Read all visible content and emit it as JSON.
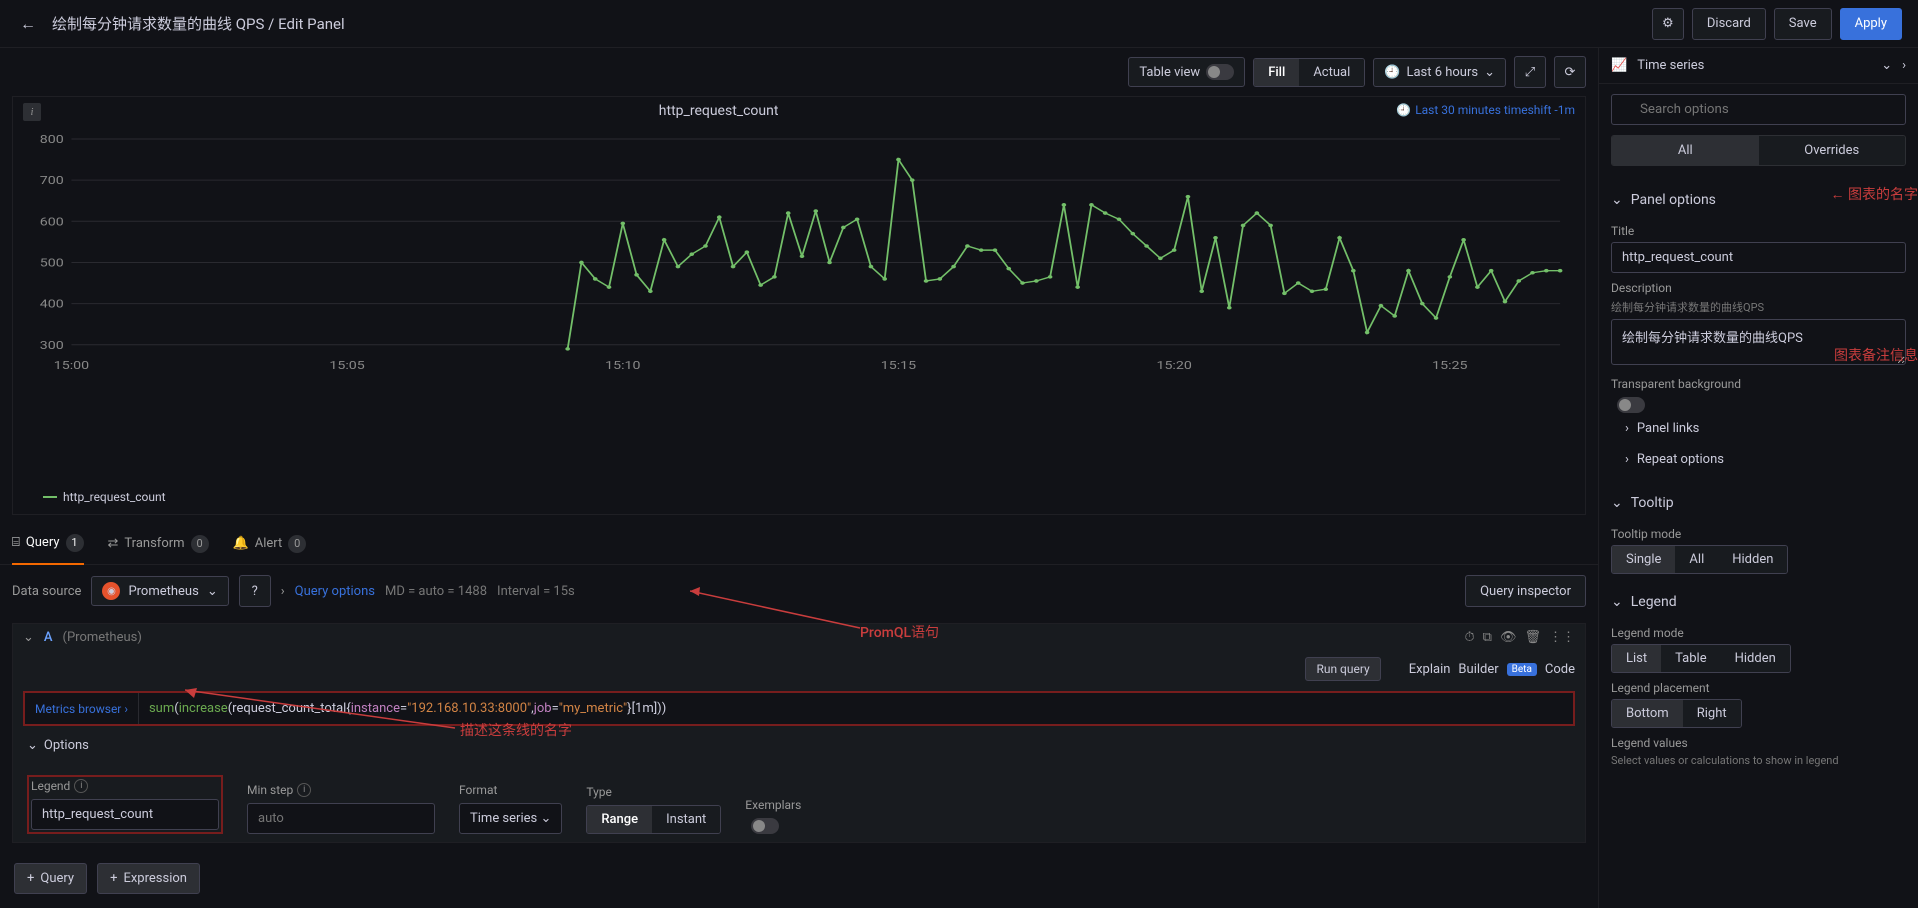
{
  "header": {
    "breadcrumb_dashboard": "绘制每分钟请求数量的曲线 QPS",
    "breadcrumb_sep": " / ",
    "breadcrumb_page": "Edit Panel",
    "discard": "Discard",
    "save": "Save",
    "apply": "Apply"
  },
  "toolbar": {
    "table_view": "Table view",
    "fill": "Fill",
    "actual": "Actual",
    "time_range": "Last 6 hours"
  },
  "panel": {
    "title": "http_request_count",
    "timeshift_label": "Last 30 minutes timeshift -1m",
    "legend_series": "http_request_count",
    "y_ticks": [
      "800",
      "700",
      "600",
      "500",
      "400",
      "300"
    ],
    "x_ticks": [
      "15:00",
      "15:05",
      "15:10",
      "15:15",
      "15:20",
      "15:25"
    ]
  },
  "tabs": {
    "query": "Query",
    "query_n": "1",
    "transform": "Transform",
    "transform_n": "0",
    "alert": "Alert",
    "alert_n": "0"
  },
  "datasource": {
    "label": "Data source",
    "name": "Prometheus",
    "query_options": "Query options",
    "md_info": "MD = auto = 1488",
    "interval_info": "Interval = 15s",
    "inspector": "Query inspector"
  },
  "query": {
    "letter": "A",
    "ds_hint": "(Prometheus)",
    "run": "Run query",
    "explain": "Explain",
    "builder": "Builder",
    "beta": "Beta",
    "code": "Code",
    "metrics_browser": "Metrics browser",
    "promql": {
      "fn1": "sum",
      "p1": "(",
      "fn2": "increase",
      "p2": "(request_count_total{",
      "k1": "instance",
      "eq1": "=",
      "v1": "\"192.168.10.33:8000\"",
      "c1": ",",
      "k2": "job",
      "eq2": "=",
      "v2": "\"my_metric\"",
      "p3": "}[1m]))"
    },
    "options_label": "Options",
    "legend_label": "Legend",
    "legend_value": "http_request_count",
    "minstep_label": "Min step",
    "minstep_placeholder": "auto",
    "format_label": "Format",
    "format_value": "Time series",
    "type_label": "Type",
    "type_range": "Range",
    "type_instant": "Instant",
    "exemplars_label": "Exemplars",
    "add_query": "Query",
    "add_expr": "Expression"
  },
  "sidebar": {
    "vis_name": "Time series",
    "search_placeholder": "Search options",
    "tab_all": "All",
    "tab_over": "Overrides",
    "panel_options": "Panel options",
    "title_label": "Title",
    "title_value": "http_request_count",
    "desc_label": "Description",
    "desc_hint": "绘制每分钟请求数量的曲线QPS",
    "desc_value": "绘制每分钟请求数量的曲线QPS",
    "transparent_label": "Transparent background",
    "panel_links": "Panel links",
    "repeat": "Repeat options",
    "tooltip": "Tooltip",
    "tooltip_mode": "Tooltip mode",
    "tm_single": "Single",
    "tm_all": "All",
    "tm_hidden": "Hidden",
    "legend": "Legend",
    "legend_mode": "Legend mode",
    "lm_list": "List",
    "lm_table": "Table",
    "lm_hidden": "Hidden",
    "legend_place": "Legend placement",
    "lp_bottom": "Bottom",
    "lp_right": "Right",
    "legend_values": "Legend values",
    "legend_values_hint": "Select values or calculations to show in legend"
  },
  "annotations": {
    "a1": "图表的名字",
    "a2": "图表备注信息",
    "a3": "PromQL语句",
    "a4": "描述这条线的名字"
  },
  "chart_data": {
    "type": "line",
    "title": "http_request_count",
    "ylabel": "",
    "xlabel": "",
    "ylim": [
      280,
      800
    ],
    "x": [
      "15:09:00",
      "15:09:15",
      "15:09:30",
      "15:09:45",
      "15:10:00",
      "15:10:15",
      "15:10:30",
      "15:10:45",
      "15:11:00",
      "15:11:15",
      "15:11:30",
      "15:11:45",
      "15:12:00",
      "15:12:15",
      "15:12:30",
      "15:12:45",
      "15:13:00",
      "15:13:15",
      "15:13:30",
      "15:13:45",
      "15:14:00",
      "15:14:15",
      "15:14:30",
      "15:14:45",
      "15:15:00",
      "15:15:15",
      "15:15:30",
      "15:15:45",
      "15:16:00",
      "15:16:15",
      "15:16:30",
      "15:16:45",
      "15:17:00",
      "15:17:15",
      "15:17:30",
      "15:17:45",
      "15:18:00",
      "15:18:15",
      "15:18:30",
      "15:18:45",
      "15:19:00",
      "15:19:15",
      "15:19:30",
      "15:19:45",
      "15:20:00",
      "15:20:15",
      "15:20:30",
      "15:20:45",
      "15:21:00",
      "15:21:15",
      "15:21:30",
      "15:21:45",
      "15:22:00",
      "15:22:15",
      "15:22:30",
      "15:22:45",
      "15:23:00",
      "15:23:15",
      "15:23:30",
      "15:23:45",
      "15:24:00",
      "15:24:15",
      "15:24:30",
      "15:24:45",
      "15:25:00",
      "15:25:15",
      "15:25:30",
      "15:25:45",
      "15:26:00",
      "15:26:15",
      "15:26:30",
      "15:26:45",
      "15:27:00"
    ],
    "series": [
      {
        "name": "http_request_count",
        "color": "#73bf69",
        "values": [
          290,
          500,
          460,
          440,
          595,
          470,
          430,
          555,
          490,
          520,
          540,
          610,
          490,
          525,
          445,
          465,
          620,
          515,
          625,
          500,
          585,
          605,
          490,
          460,
          750,
          700,
          455,
          460,
          490,
          540,
          530,
          530,
          485,
          450,
          455,
          465,
          640,
          440,
          640,
          620,
          605,
          570,
          540,
          510,
          530,
          660,
          430,
          560,
          390,
          590,
          620,
          590,
          425,
          450,
          430,
          435,
          560,
          480,
          330,
          395,
          370,
          480,
          400,
          365,
          465,
          555,
          440,
          480,
          405,
          455,
          475,
          480,
          480
        ]
      }
    ]
  }
}
